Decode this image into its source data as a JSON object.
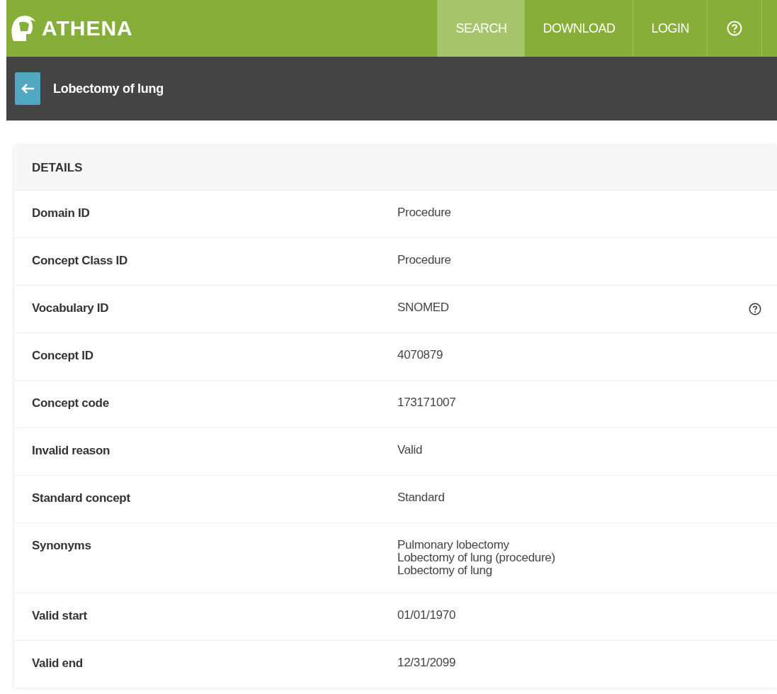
{
  "header": {
    "logo": "ATHENA",
    "nav": [
      {
        "kind": "text",
        "label": "SEARCH",
        "selected": true
      },
      {
        "kind": "text",
        "label": "DOWNLOAD",
        "selected": false
      },
      {
        "kind": "text",
        "label": "LOGIN",
        "selected": false
      },
      {
        "kind": "help",
        "selected": false
      }
    ]
  },
  "title_bar": {
    "title": "Lobectomy of lung"
  },
  "details": {
    "heading": "DETAILS",
    "rows": [
      {
        "label": "Domain ID",
        "values": [
          "Procedure"
        ],
        "info": false
      },
      {
        "label": "Concept Class ID",
        "values": [
          "Procedure"
        ],
        "info": false
      },
      {
        "label": "Vocabulary ID",
        "values": [
          "SNOMED"
        ],
        "info": true
      },
      {
        "label": "Concept ID",
        "values": [
          "4070879"
        ],
        "info": false
      },
      {
        "label": "Concept code",
        "values": [
          "173171007"
        ],
        "info": false
      },
      {
        "label": "Invalid reason",
        "values": [
          "Valid"
        ],
        "info": false
      },
      {
        "label": "Standard concept",
        "values": [
          "Standard"
        ],
        "info": false
      },
      {
        "label": "Synonyms",
        "values": [
          "Pulmonary lobectomy",
          "Lobectomy of lung (procedure)",
          "Lobectomy of lung"
        ],
        "info": false
      },
      {
        "label": "Valid start",
        "values": [
          "01/01/1970"
        ],
        "info": false
      },
      {
        "label": "Valid end",
        "values": [
          "12/31/2099"
        ],
        "info": false
      }
    ]
  }
}
